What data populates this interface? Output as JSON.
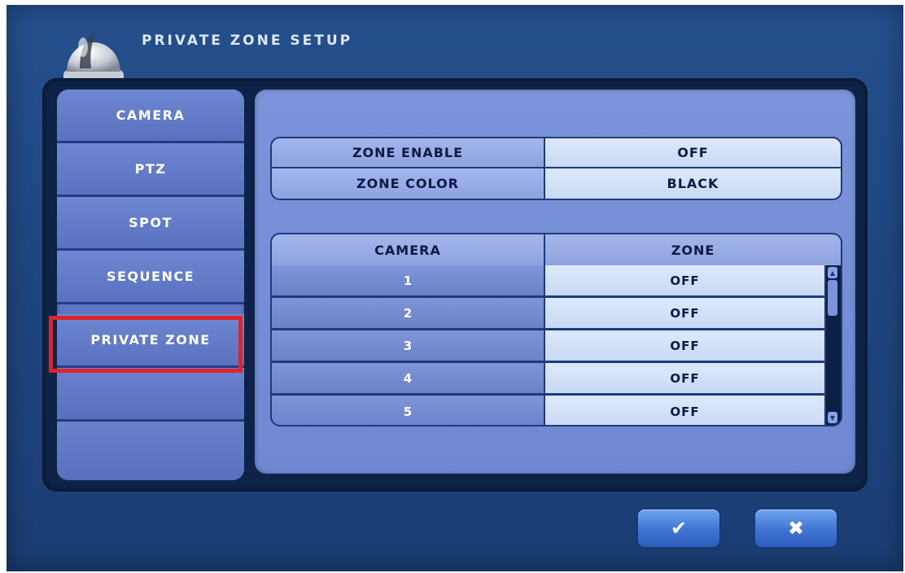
{
  "title": "PRIVATE ZONE SETUP",
  "icons": {
    "header": "dome-camera-icon",
    "ok": "checkmark-icon",
    "cancel": "close-icon"
  },
  "sidebar": {
    "items": [
      {
        "label": "CAMERA"
      },
      {
        "label": "PTZ"
      },
      {
        "label": "SPOT"
      },
      {
        "label": "SEQUENCE"
      },
      {
        "label": "PRIVATE ZONE",
        "selected": true
      },
      {
        "label": ""
      },
      {
        "label": ""
      }
    ]
  },
  "settings": {
    "zone_enable": {
      "label": "ZONE ENABLE",
      "value": "OFF"
    },
    "zone_color": {
      "label": "ZONE COLOR",
      "value": "BLACK"
    }
  },
  "table": {
    "headers": [
      "CAMERA",
      "ZONE"
    ],
    "rows": [
      {
        "camera": "1",
        "zone": "OFF"
      },
      {
        "camera": "2",
        "zone": "OFF"
      },
      {
        "camera": "3",
        "zone": "OFF"
      },
      {
        "camera": "4",
        "zone": "OFF"
      },
      {
        "camera": "5",
        "zone": "OFF"
      }
    ]
  },
  "buttons": {
    "ok_symbol": "✔",
    "cancel_symbol": "✖"
  },
  "colors": {
    "background": "#1f4680",
    "highlight": "#e0242c",
    "panel": "#7c94db",
    "button": "#3f74d2"
  }
}
